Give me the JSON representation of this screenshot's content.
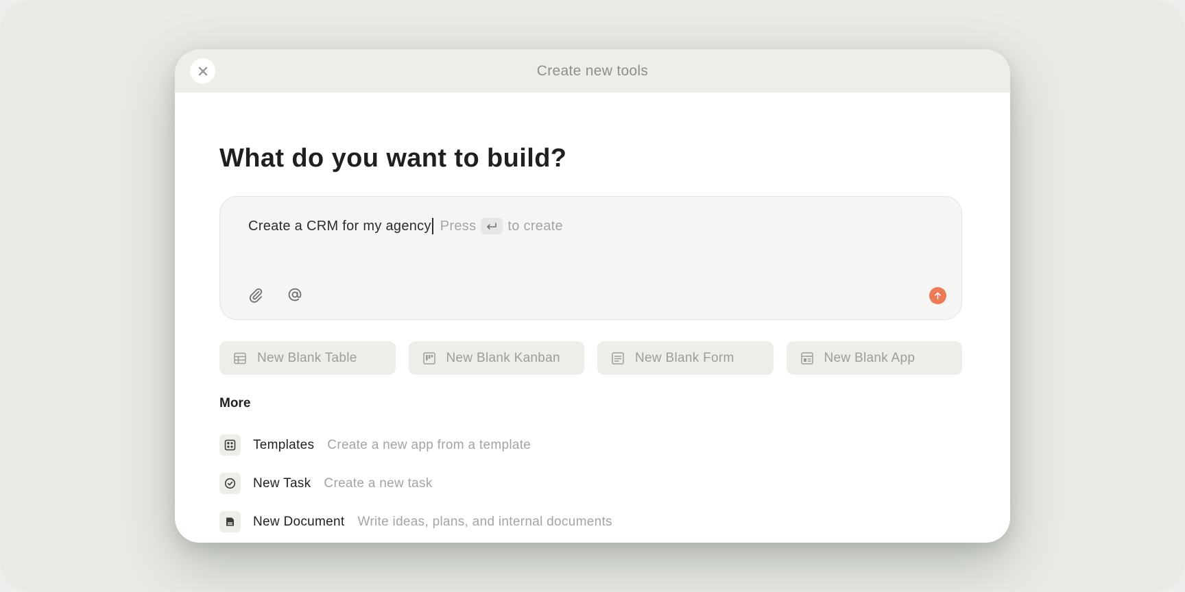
{
  "dialog": {
    "title": "Create new tools",
    "headline": "What do you want to build?"
  },
  "prompt": {
    "value": "Create a CRM for my agency",
    "hint_prefix": "Press",
    "hint_suffix": "to create"
  },
  "quick_actions": [
    {
      "label": "New Blank Table",
      "icon": "table-icon"
    },
    {
      "label": "New Blank Kanban",
      "icon": "kanban-icon"
    },
    {
      "label": "New Blank Form",
      "icon": "form-icon"
    },
    {
      "label": "New Blank App",
      "icon": "app-icon"
    }
  ],
  "more": {
    "label": "More",
    "items": [
      {
        "title": "Templates",
        "description": "Create a new app from a template",
        "icon": "templates-icon"
      },
      {
        "title": "New Task",
        "description": "Create a new task",
        "icon": "check-circle-icon"
      },
      {
        "title": "New Document",
        "description": "Write ideas, plans, and internal documents",
        "icon": "document-icon"
      }
    ]
  },
  "colors": {
    "accent": "#ec7a54",
    "background": "#ebeeea",
    "header": "#eceeea"
  }
}
